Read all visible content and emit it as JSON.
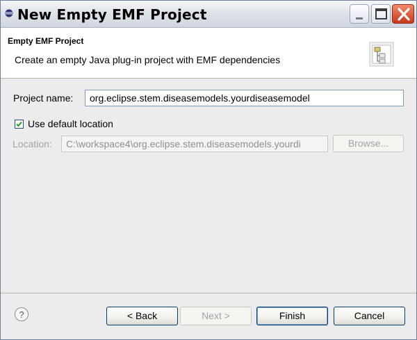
{
  "window": {
    "title": "New Empty EMF Project"
  },
  "header": {
    "title": "Empty EMF Project",
    "description": "Create an empty Java plug-in project with EMF dependencies",
    "icon": "wizard-banner-icon"
  },
  "form": {
    "project_name_label": "Project name:",
    "project_name_value": "org.eclipse.stem.diseasemodels.yourdiseasemodel",
    "use_default_location_label": "Use default location",
    "use_default_location_checked": true,
    "location_label": "Location:",
    "location_value": "C:\\workspace4\\org.eclipse.stem.diseasemodels.yourdi",
    "browse_label": "Browse..."
  },
  "footer": {
    "help_icon": "help-icon",
    "back_label": "< Back",
    "next_label": "Next >",
    "finish_label": "Finish",
    "cancel_label": "Cancel"
  }
}
